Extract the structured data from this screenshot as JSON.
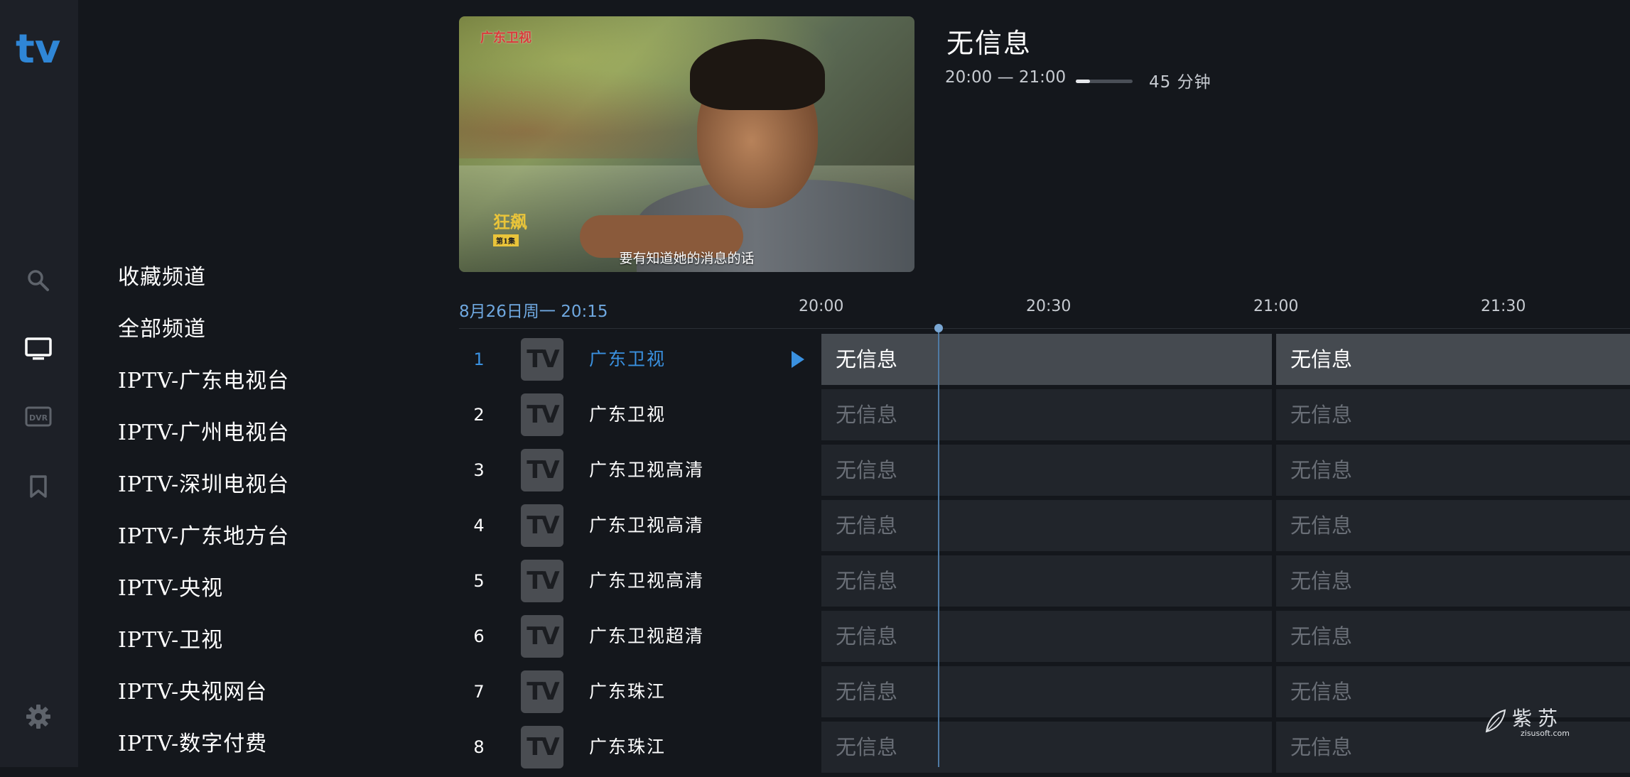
{
  "app": {
    "logo_text": "tv",
    "accent_color": "#3a91e0"
  },
  "rail": {
    "items": [
      {
        "icon": "search-icon"
      },
      {
        "icon": "tv-icon",
        "selected": true
      },
      {
        "icon": "dvr-icon",
        "label": "DVR"
      },
      {
        "icon": "bookmark-icon"
      },
      {
        "icon": "gear-icon"
      }
    ]
  },
  "categories": [
    "收藏频道",
    "全部频道",
    "IPTV-广东电视台",
    "IPTV-广州电视台",
    "IPTV-深圳电视台",
    "IPTV-广东地方台",
    "IPTV-央视",
    "IPTV-卫视",
    "IPTV-央视网台",
    "IPTV-数字付费"
  ],
  "preview": {
    "channel_logo_text": "广东卫视",
    "show_logo_text": "狂飙",
    "show_episode_text": "第1集",
    "subtitle": "要有知道她的消息的话"
  },
  "program": {
    "title": "无信息",
    "time_range": "20:00 — 21:00",
    "progress": 0.25,
    "remaining": "45 分钟"
  },
  "guide": {
    "current_datetime": "8月26日周一 20:15",
    "time_slots": [
      "20:00",
      "20:30",
      "21:00",
      "21:30"
    ],
    "channels": [
      {
        "number": "1",
        "logo": "TV",
        "name": "广东卫视",
        "programs": [
          "无信息",
          "无信息"
        ],
        "active": true
      },
      {
        "number": "2",
        "logo": "TV",
        "name": "广东卫视",
        "programs": [
          "无信息",
          "无信息"
        ]
      },
      {
        "number": "3",
        "logo": "TV",
        "name": "广东卫视高清",
        "programs": [
          "无信息",
          "无信息"
        ]
      },
      {
        "number": "4",
        "logo": "TV",
        "name": "广东卫视高清",
        "programs": [
          "无信息",
          "无信息"
        ]
      },
      {
        "number": "5",
        "logo": "TV",
        "name": "广东卫视高清",
        "programs": [
          "无信息",
          "无信息"
        ]
      },
      {
        "number": "6",
        "logo": "TV",
        "name": "广东卫视超清",
        "programs": [
          "无信息",
          "无信息"
        ]
      },
      {
        "number": "7",
        "logo": "TV",
        "name": "广东珠江",
        "programs": [
          "无信息",
          "无信息"
        ]
      },
      {
        "number": "8",
        "logo": "TV",
        "name": "广东珠江",
        "programs": [
          "无信息",
          "无信息"
        ]
      }
    ]
  },
  "watermark": {
    "text": "紫苏",
    "sub_text": "zisusoft.com"
  }
}
